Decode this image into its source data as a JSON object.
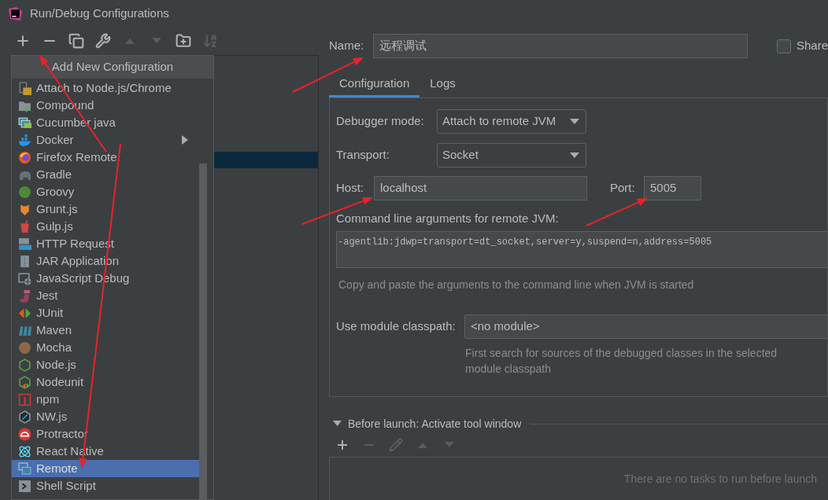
{
  "window": {
    "title": "Run/Debug Configurations"
  },
  "toolbar": [
    {
      "kind": "add",
      "disabled": false
    },
    {
      "kind": "remove",
      "disabled": false
    },
    {
      "kind": "copy",
      "disabled": false
    },
    {
      "kind": "edit",
      "disabled": false
    },
    {
      "kind": "up",
      "disabled": true
    },
    {
      "kind": "down",
      "disabled": true
    },
    {
      "kind": "folder",
      "disabled": false
    },
    {
      "kind": "sort",
      "disabled": true
    }
  ],
  "popup": {
    "title": "Add New Configuration",
    "items": [
      {
        "label": "Attach to Node.js/Chrome",
        "submenu": false,
        "selected": false
      },
      {
        "label": "Compound",
        "submenu": false,
        "selected": false
      },
      {
        "label": "Cucumber java",
        "submenu": false,
        "selected": false
      },
      {
        "label": "Docker",
        "submenu": true,
        "selected": false
      },
      {
        "label": "Firefox Remote",
        "submenu": false,
        "selected": false
      },
      {
        "label": "Gradle",
        "submenu": false,
        "selected": false
      },
      {
        "label": "Groovy",
        "submenu": false,
        "selected": false
      },
      {
        "label": "Grunt.js",
        "submenu": false,
        "selected": false
      },
      {
        "label": "Gulp.js",
        "submenu": false,
        "selected": false
      },
      {
        "label": "HTTP Request",
        "submenu": false,
        "selected": false
      },
      {
        "label": "JAR Application",
        "submenu": false,
        "selected": false
      },
      {
        "label": "JavaScript Debug",
        "submenu": false,
        "selected": false
      },
      {
        "label": "Jest",
        "submenu": false,
        "selected": false
      },
      {
        "label": "JUnit",
        "submenu": false,
        "selected": false
      },
      {
        "label": "Maven",
        "submenu": false,
        "selected": false
      },
      {
        "label": "Mocha",
        "submenu": false,
        "selected": false
      },
      {
        "label": "Node.js",
        "submenu": false,
        "selected": false
      },
      {
        "label": "Nodeunit",
        "submenu": false,
        "selected": false
      },
      {
        "label": "npm",
        "submenu": false,
        "selected": false
      },
      {
        "label": "NW.js",
        "submenu": false,
        "selected": false
      },
      {
        "label": "Protractor",
        "submenu": false,
        "selected": false
      },
      {
        "label": "React Native",
        "submenu": false,
        "selected": false
      },
      {
        "label": "Remote",
        "submenu": false,
        "selected": true
      },
      {
        "label": "Shell Script",
        "submenu": false,
        "selected": false
      }
    ]
  },
  "name": {
    "label": "Name:",
    "value": "远程调试"
  },
  "share": {
    "label": "Share",
    "checked": false
  },
  "tabs": [
    {
      "label": "Configuration",
      "selected": true
    },
    {
      "label": "Logs",
      "selected": false
    }
  ],
  "debugger_mode": {
    "label": "Debugger mode:",
    "value": "Attach to remote JVM"
  },
  "transport": {
    "label": "Transport:",
    "value": "Socket"
  },
  "host": {
    "label": "Host:",
    "value": "localhost"
  },
  "port": {
    "label": "Port:",
    "value": "5005"
  },
  "command_line": {
    "label": "Command line arguments for remote JVM:",
    "value": "-agentlib:jdwp=transport=dt_socket,server=y,suspend=n,address=5005",
    "hint": "Copy and paste the arguments to the command line when JVM is started"
  },
  "module_classpath": {
    "label": "Use module classpath:",
    "value": "<no module>",
    "hint": "First search for sources of the debugged classes in the selected module classpath"
  },
  "before_launch": {
    "title": "Before launch: Activate tool window",
    "expanded": true,
    "toolbar": [
      {
        "kind": "add",
        "disabled": false
      },
      {
        "kind": "remove",
        "disabled": true
      },
      {
        "kind": "edit",
        "disabled": true
      },
      {
        "kind": "up",
        "disabled": true
      },
      {
        "kind": "down",
        "disabled": true
      }
    ],
    "empty_text": "There are no tasks to run before launch"
  }
}
